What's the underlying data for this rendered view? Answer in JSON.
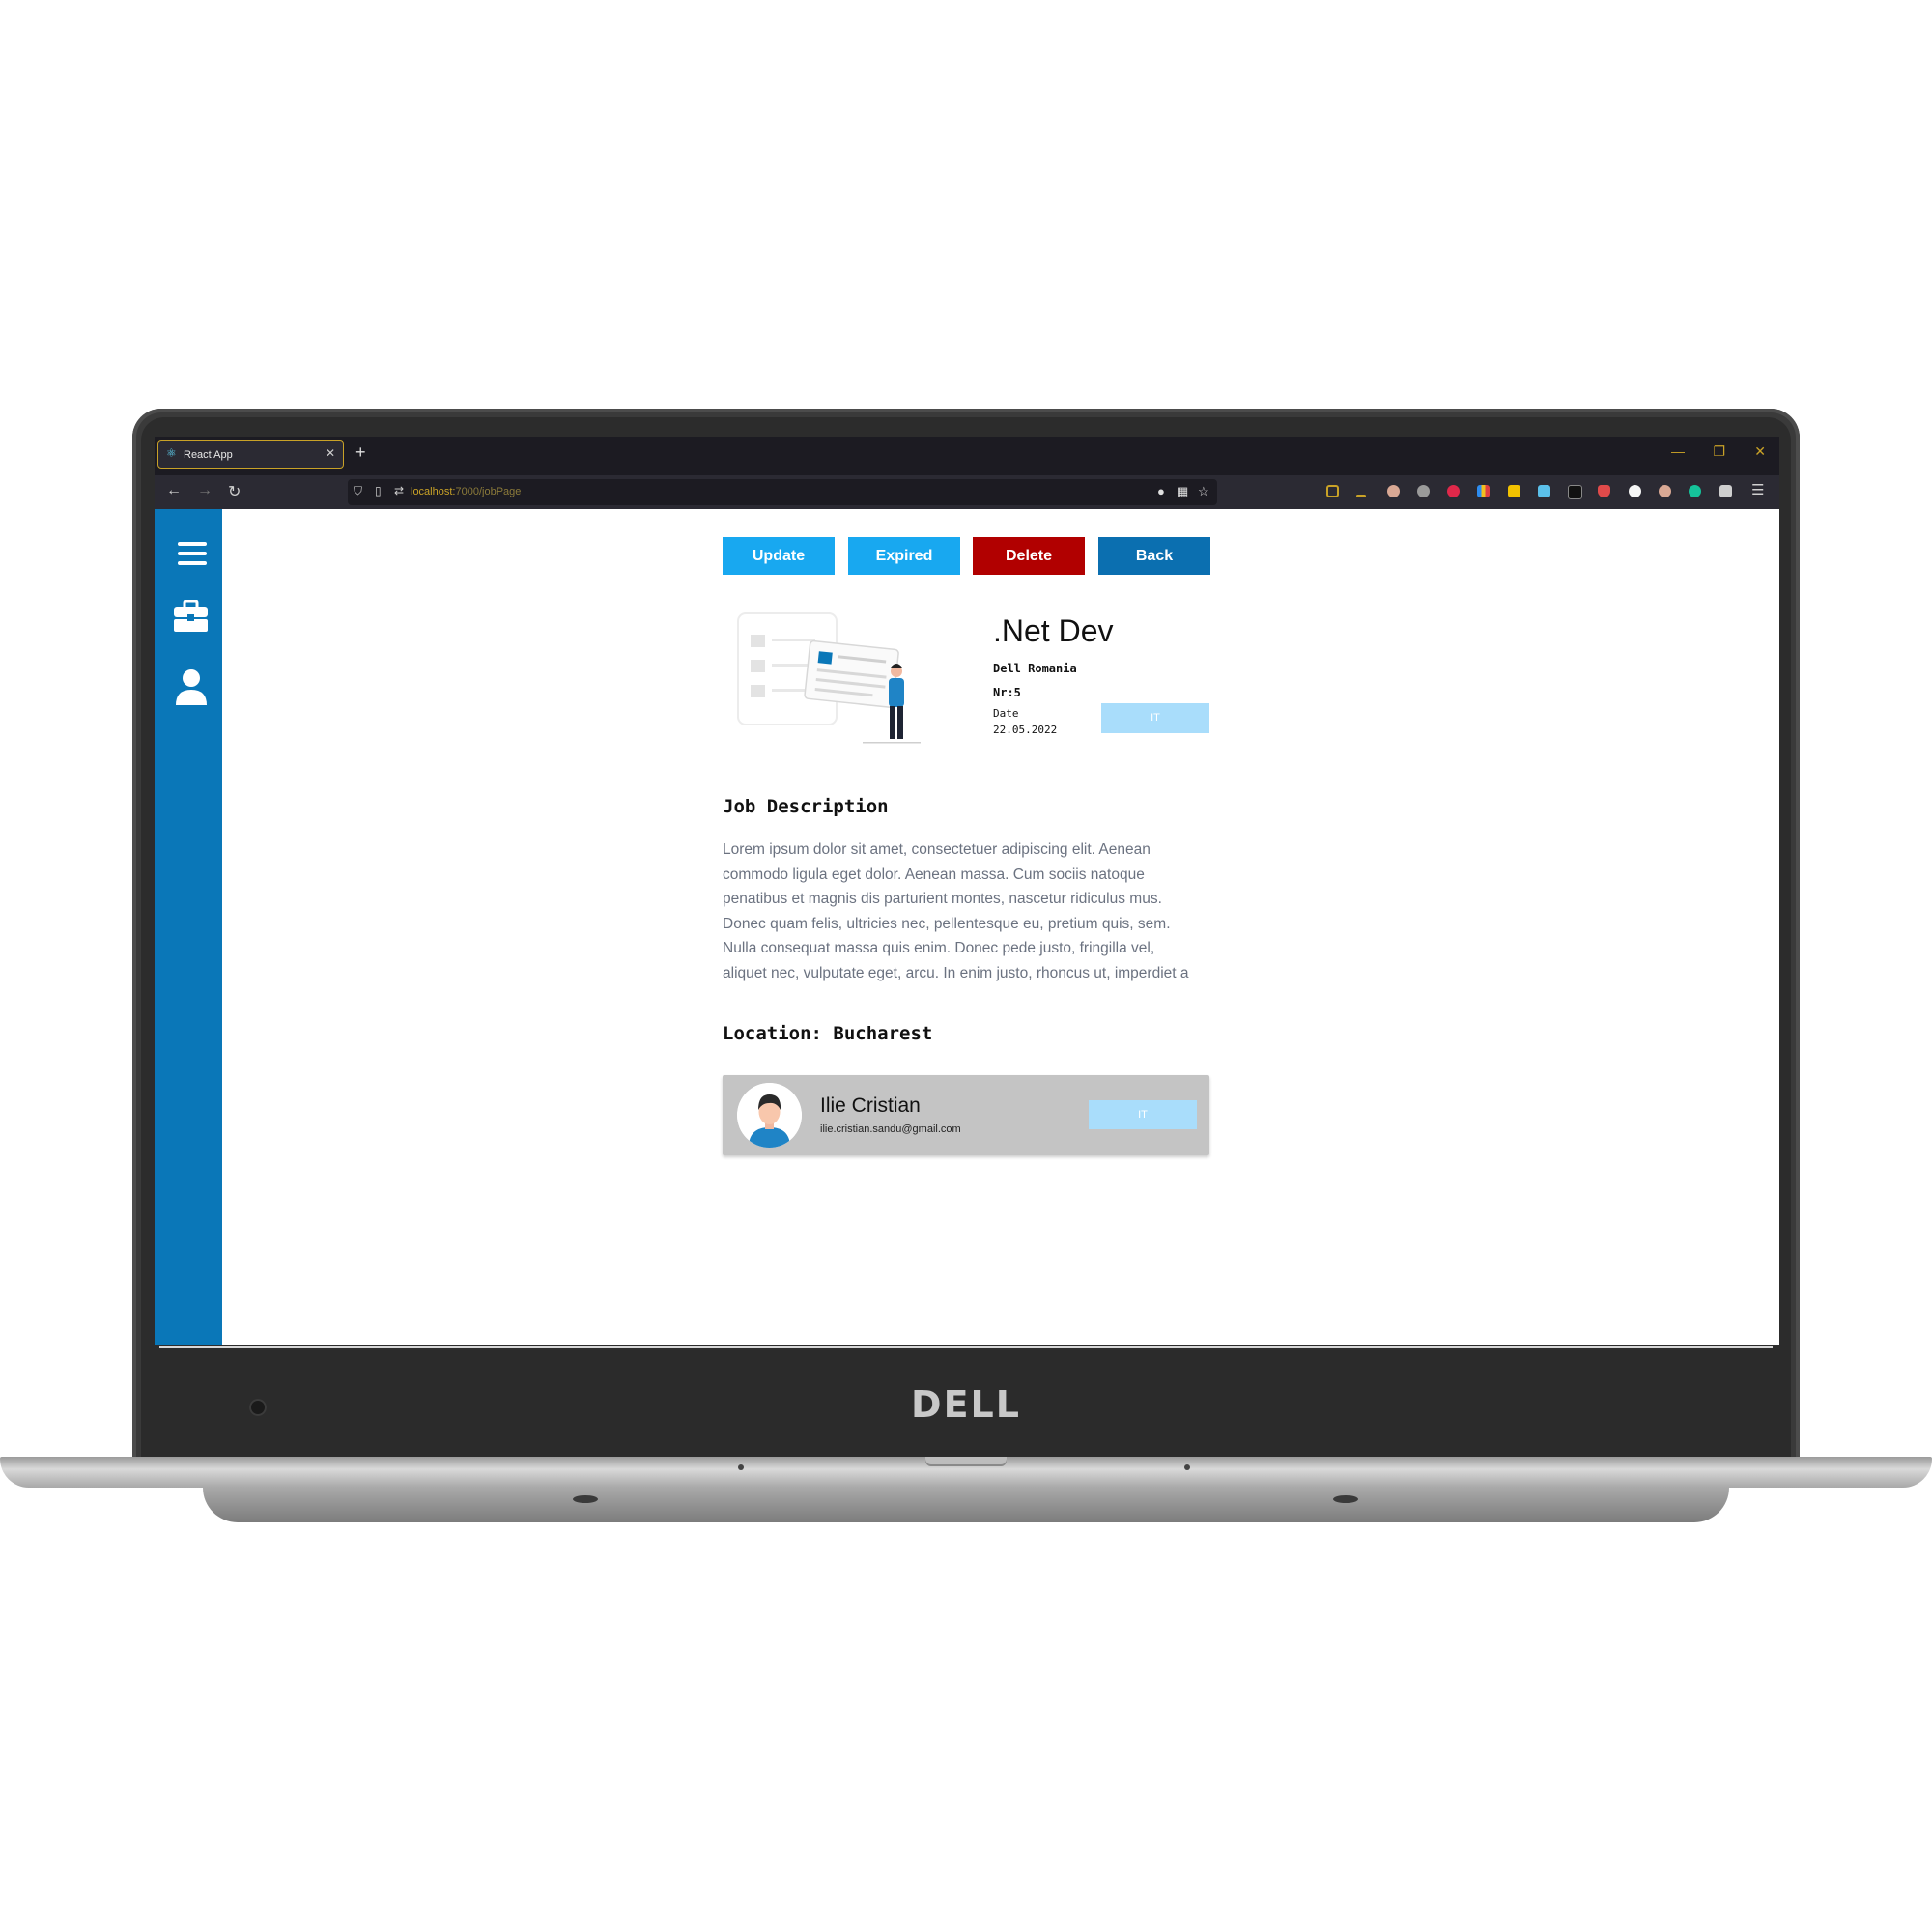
{
  "laptop": {
    "brand": "DELL"
  },
  "browser": {
    "tab_title": "React App",
    "new_tab_symbol": "+",
    "url_host": "localhost:",
    "url_path": "7000/jobPage",
    "window_controls": {
      "minimize": "—",
      "restore": "❐",
      "close": "✕"
    }
  },
  "sidebar": {
    "items": [
      {
        "icon": "hamburger-menu-icon"
      },
      {
        "icon": "briefcase-icon"
      },
      {
        "icon": "user-icon"
      }
    ],
    "color": "#0a77b8"
  },
  "actions": {
    "update": "Update",
    "expired": "Expired",
    "delete": "Delete",
    "back": "Back"
  },
  "job": {
    "title": ".Net Dev",
    "company": "Dell Romania",
    "number": "Nr:5",
    "date_label": "Date",
    "date_value": "22.05.2022",
    "category": "IT",
    "description_heading": "Job Description",
    "description": "Lorem ipsum dolor sit amet, consectetuer adipiscing elit. Aenean commodo ligula eget dolor. Aenean massa. Cum sociis natoque penatibus et magnis dis parturient montes, nascetur ridiculus mus. Donec quam felis, ultricies nec, pellentesque eu, pretium quis, sem. Nulla consequat massa quis enim. Donec pede justo, fringilla vel, aliquet nec, vulputate eget, arcu. In enim justo, rhoncus ut, imperdiet a",
    "location": "Location: Bucharest"
  },
  "contact": {
    "name": "Ilie Cristian",
    "email": "ilie.cristian.sandu@gmail.com",
    "category": "IT"
  },
  "colors": {
    "primary_button": "#18a8f0",
    "delete_button": "#b10000",
    "back_button": "#0b6fb0",
    "badge": "#a9ddfb",
    "card_background": "#c4c4c4"
  }
}
